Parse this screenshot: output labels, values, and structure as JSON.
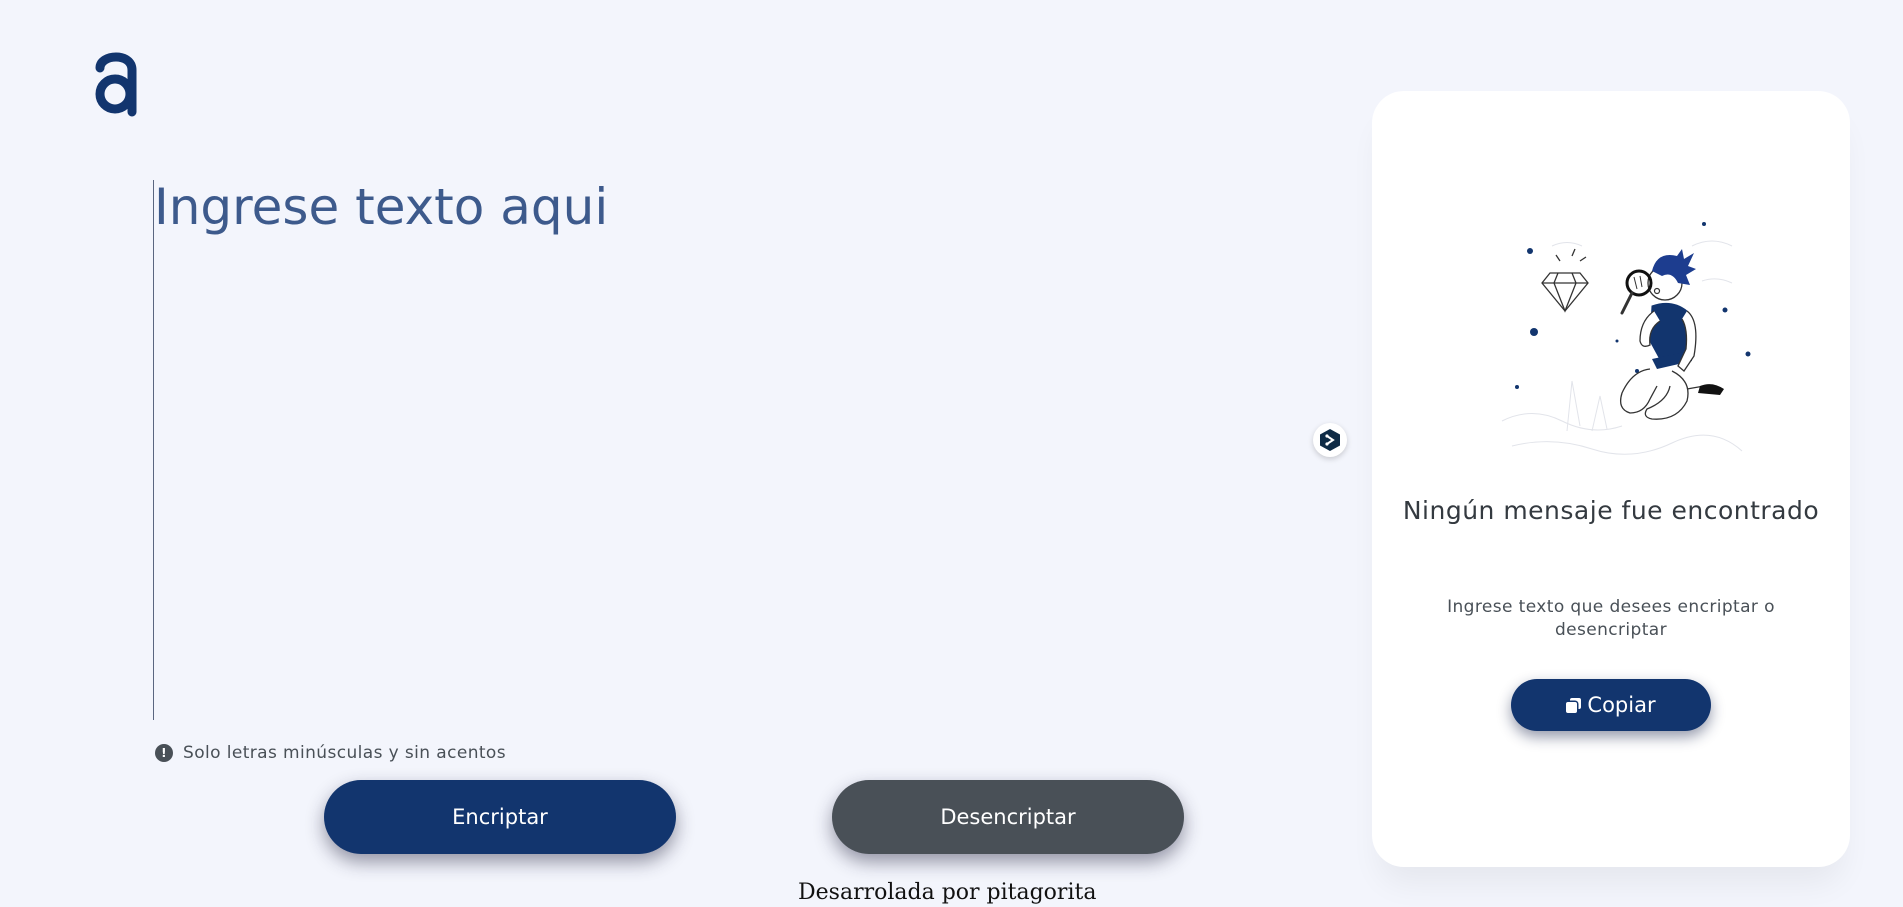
{
  "logo": {
    "glyph": "a",
    "color": "#12356e"
  },
  "editor": {
    "placeholder": "Ingrese texto aqui",
    "value": ""
  },
  "warning": {
    "icon": "exclamation-circle-icon",
    "text": "Solo letras minúsculas y sin acentos"
  },
  "actions": {
    "encrypt_label": "Encriptar",
    "decrypt_label": "Desencriptar"
  },
  "footer": {
    "text": "Desarrolada por pitagorita"
  },
  "extension": {
    "icon": "translate-extension-icon"
  },
  "result_panel": {
    "illustration": "person-with-magnifying-glass-illustration",
    "title": "Ningún mensaje fue encontrado",
    "description": "Ingrese texto que desees encriptar o desencriptar",
    "copy_label": "Copiar",
    "copy_icon": "copy-icon"
  },
  "colors": {
    "primary": "#12356e",
    "secondary": "#495057",
    "background": "#f3f5fc",
    "panel": "#ffffff"
  }
}
